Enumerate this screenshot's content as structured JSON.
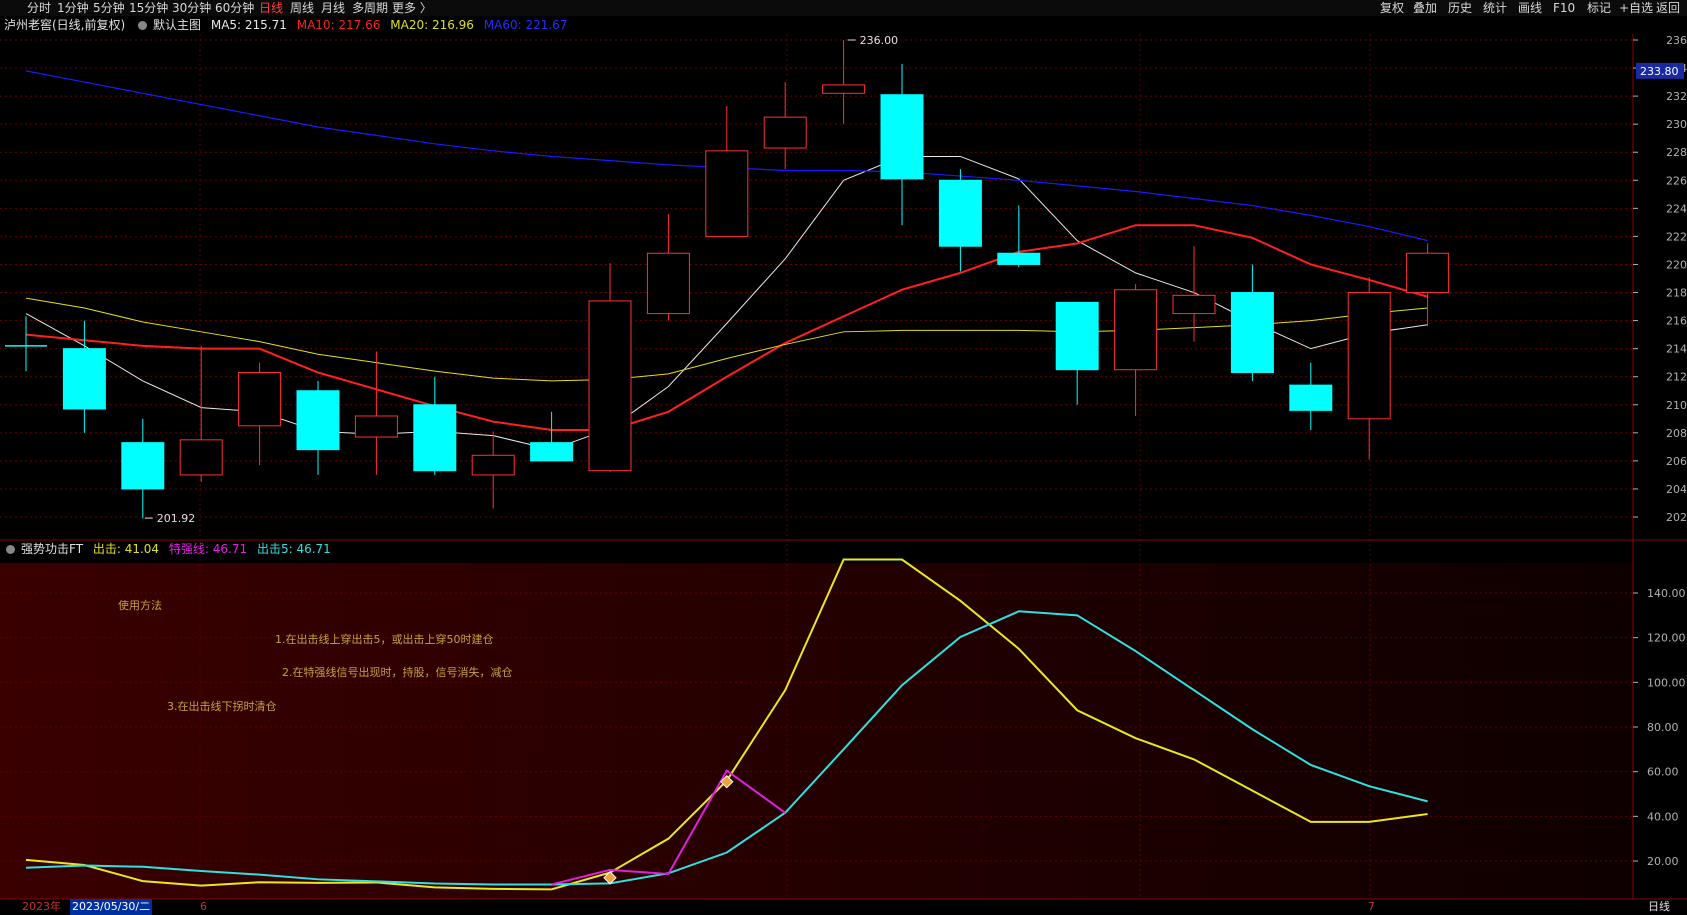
{
  "toolbar": {
    "periods": [
      "分时",
      "1分钟",
      "5分钟",
      "15分钟",
      "30分钟",
      "60分钟",
      "日线",
      "周线",
      "月线",
      "多周期",
      "更多 〉"
    ],
    "active_period": "日线",
    "right_buttons": [
      "复权",
      "叠加",
      "历史",
      "统计",
      "画线",
      "F10",
      "标记",
      "+自选",
      "返回"
    ]
  },
  "legend": {
    "stock": "泸州老窖(日线,前复权)",
    "template": "默认主图",
    "ma5": "MA5: 215.71",
    "ma10": "MA10: 217.66",
    "ma20": "MA20: 216.96",
    "ma60": "MA60: 221.67"
  },
  "colors": {
    "ma5": "#e8e8e8",
    "ma10": "#ff2020",
    "ma20": "#e0e020",
    "ma60": "#1a1aff",
    "up": "#ff3030",
    "down": "#00ffff",
    "grid": "#6a0000",
    "axis": "#b0b0b0"
  },
  "price_axis": {
    "ticks": [
      "236.0",
      "234.0",
      "232.0",
      "230.0",
      "228.0",
      "226.0",
      "224.0",
      "222.0",
      "220.0",
      "218.0",
      "216.0",
      "214.0",
      "212.0",
      "210.0",
      "208.0",
      "206.0",
      "204.0",
      "202.0"
    ],
    "current": "233.80"
  },
  "annotations": {
    "high": "236.00",
    "low": "201.92"
  },
  "indicator": {
    "name": "强势功击FT",
    "chuji": "出击: 41.04",
    "techiang": "特强线: 46.71",
    "chuji5": "出击5: 46.71",
    "ticks": [
      "140.00",
      "120.00",
      "100.00",
      "80.00",
      "60.00",
      "40.00",
      "20.00"
    ],
    "notes": [
      "使用方法",
      "1.在出击线上穿出击5，或出击上穿50时建仓",
      "2.在特强线信号出现时，持股，信号消失，减仓",
      "3.在出击线下拐时清仓"
    ]
  },
  "bottom": {
    "year": "2023年",
    "date": "2023/05/30/二",
    "m6": "6",
    "m7": "7",
    "period": "日线"
  },
  "chart_data": [
    {
      "type": "candlestick",
      "title": "泸州老窖(日线,前复权)",
      "ylim": [
        201,
        237
      ],
      "candles": [
        {
          "o": 214.2,
          "h": 216.3,
          "l": 212.4,
          "c": 214.1
        },
        {
          "o": 214.0,
          "h": 216.0,
          "l": 208.0,
          "c": 209.7
        },
        {
          "o": 207.3,
          "h": 209.0,
          "l": 201.9,
          "c": 204.0
        },
        {
          "o": 205.0,
          "h": 214.2,
          "l": 204.5,
          "c": 207.5
        },
        {
          "o": 208.5,
          "h": 213.0,
          "l": 205.7,
          "c": 212.3
        },
        {
          "o": 211.0,
          "h": 211.7,
          "l": 205.0,
          "c": 206.8
        },
        {
          "o": 207.7,
          "h": 213.8,
          "l": 205.0,
          "c": 209.2
        },
        {
          "o": 210.0,
          "h": 212.0,
          "l": 205.0,
          "c": 205.3
        },
        {
          "o": 205.0,
          "h": 208.1,
          "l": 202.6,
          "c": 206.4
        },
        {
          "o": 207.3,
          "h": 209.5,
          "l": 206.0,
          "c": 206.0
        },
        {
          "o": 205.3,
          "h": 220.1,
          "l": 205.2,
          "c": 217.4
        },
        {
          "o": 216.5,
          "h": 223.6,
          "l": 216.0,
          "c": 220.8
        },
        {
          "o": 222.0,
          "h": 231.3,
          "l": 222.0,
          "c": 228.1
        },
        {
          "o": 228.3,
          "h": 233.0,
          "l": 226.8,
          "c": 230.5
        },
        {
          "o": 232.2,
          "h": 236.0,
          "l": 230.0,
          "c": 232.8
        },
        {
          "o": 232.1,
          "h": 234.3,
          "l": 222.8,
          "c": 226.1
        },
        {
          "o": 226.0,
          "h": 226.8,
          "l": 219.5,
          "c": 221.3
        },
        {
          "o": 220.8,
          "h": 224.2,
          "l": 219.8,
          "c": 220.0
        },
        {
          "o": 217.3,
          "h": 217.3,
          "l": 210.0,
          "c": 212.5
        },
        {
          "o": 212.5,
          "h": 218.6,
          "l": 209.2,
          "c": 218.2
        },
        {
          "o": 216.5,
          "h": 221.3,
          "l": 214.5,
          "c": 217.8
        },
        {
          "o": 218.0,
          "h": 220.0,
          "l": 211.7,
          "c": 212.3
        },
        {
          "o": 211.4,
          "h": 213.0,
          "l": 208.2,
          "c": 209.6
        },
        {
          "o": 209.0,
          "h": 219.1,
          "l": 206.1,
          "c": 218.0
        },
        {
          "o": 218.0,
          "h": 221.5,
          "l": 215.6,
          "c": 220.8
        }
      ],
      "series": [
        {
          "name": "MA5",
          "values": [
            216.5,
            214.2,
            211.7,
            209.8,
            209.5,
            208.1,
            207.9,
            208.1,
            207.8,
            206.8,
            208.3,
            211.3,
            215.8,
            220.4,
            226.0,
            227.7,
            227.7,
            226.1,
            221.7,
            219.4,
            218.0,
            215.9,
            214.0,
            215.1,
            215.7
          ]
        },
        {
          "name": "MA10",
          "values": [
            215.0,
            214.6,
            214.2,
            214.0,
            214.0,
            212.3,
            211.1,
            209.9,
            208.8,
            208.2,
            208.2,
            209.5,
            212.0,
            214.4,
            216.3,
            218.2,
            219.4,
            220.9,
            221.5,
            222.8,
            222.8,
            221.9,
            220.0,
            218.9,
            217.7
          ]
        },
        {
          "name": "MA20",
          "values": [
            217.6,
            216.9,
            215.9,
            215.2,
            214.5,
            213.6,
            213.0,
            212.4,
            211.9,
            211.7,
            211.8,
            212.2,
            213.3,
            214.3,
            215.2,
            215.3,
            215.3,
            215.3,
            215.2,
            215.3,
            215.5,
            215.7,
            216.0,
            216.5,
            216.9
          ]
        },
        {
          "name": "MA60",
          "values": [
            233.8,
            233.0,
            232.2,
            231.4,
            230.6,
            229.8,
            229.2,
            228.6,
            228.1,
            227.7,
            227.4,
            227.1,
            226.9,
            226.7,
            226.7,
            226.6,
            226.3,
            226.0,
            225.6,
            225.2,
            224.7,
            224.2,
            223.5,
            222.7,
            221.7
          ]
        }
      ]
    },
    {
      "type": "line",
      "title": "强势功击FT",
      "ylim": [
        12,
        155
      ],
      "series": [
        {
          "name": "出击",
          "values": [
            20.5,
            18.2,
            11.0,
            9.0,
            10.5,
            10.2,
            10.4,
            8.2,
            7.5,
            7.3,
            14.8,
            30.0,
            56.0,
            96.5,
            155,
            155,
            136.5,
            115,
            87.5,
            75,
            65.5,
            51.5,
            37.5,
            37.5,
            41.04
          ]
        },
        {
          "name": "出击5",
          "values": [
            17.0,
            18.0,
            17.4,
            15.5,
            13.9,
            11.8,
            10.9,
            9.9,
            9.5,
            9.5,
            10.0,
            14.5,
            23.8,
            41.6,
            70.0,
            98.7,
            120.3,
            131.8,
            130.0,
            114.0,
            96.5,
            79.0,
            63.0,
            53.5,
            46.71
          ]
        },
        {
          "name": "特强线",
          "values": [
            null,
            null,
            null,
            null,
            null,
            null,
            null,
            null,
            null,
            9.5,
            16.0,
            14.2,
            60.5,
            41.6,
            null,
            null,
            null,
            null,
            null,
            null,
            null,
            null,
            null,
            null,
            null
          ]
        }
      ]
    }
  ]
}
